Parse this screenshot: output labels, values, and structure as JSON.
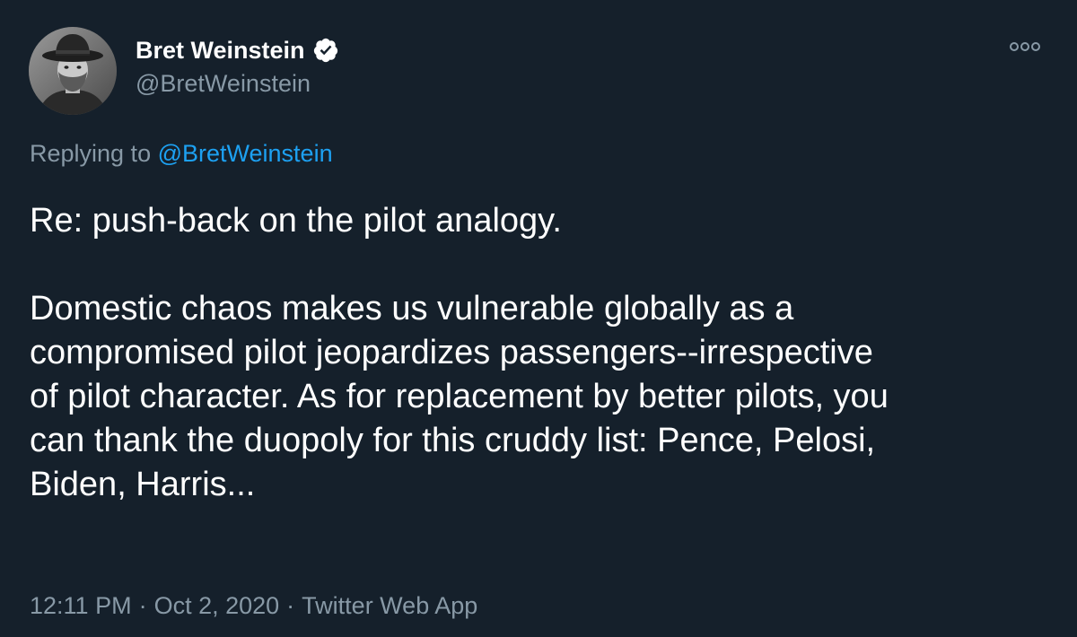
{
  "author": {
    "display_name": "Bret Weinstein",
    "handle": "@BretWeinstein",
    "verified": true,
    "avatar_icon": "profile-photo"
  },
  "reply": {
    "prefix": "Replying to ",
    "mention": "@BretWeinstein"
  },
  "tweet": {
    "lines": [
      "Re: push-back on the pilot analogy.",
      "",
      "Domestic chaos makes us vulnerable globally as a",
      "compromised pilot jeopardizes passengers--irrespective",
      "of pilot character. As for replacement by better pilots, you",
      "can thank the duopoly for this cruddy list: Pence, Pelosi,",
      "Biden, Harris..."
    ]
  },
  "meta": {
    "time": "12:11 PM",
    "separator": "·",
    "date": "Oct 2, 2020",
    "source": "Twitter Web App"
  },
  "icons": {
    "verified": "verified-badge-icon",
    "more": "more-options-icon"
  },
  "colors": {
    "background": "#15202b",
    "text_primary": "#ffffff",
    "text_secondary": "#8899a6",
    "link": "#1da1f2"
  }
}
